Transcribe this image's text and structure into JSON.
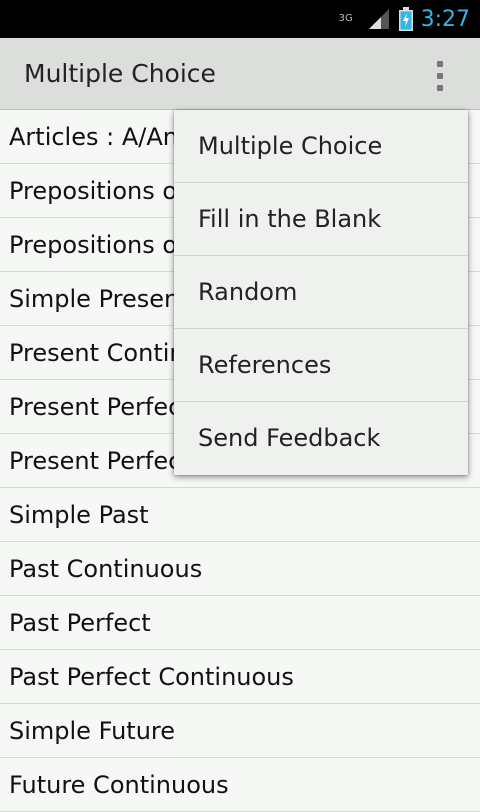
{
  "status_bar": {
    "network_type": "3G",
    "time": "3:27",
    "icons": [
      "signal-icon",
      "battery-charging-icon"
    ],
    "accent_color": "#33b5e5"
  },
  "action_bar": {
    "title": "Multiple Choice",
    "overflow_icon": "overflow-menu-icon"
  },
  "list": {
    "items": [
      "Articles : A/An",
      "Prepositions o",
      "Prepositions o",
      "Simple Presen",
      "Present Contin",
      "Present Perfec",
      "Present Perfec",
      "Simple Past",
      "Past Continuous",
      "Past Perfect",
      "Past Perfect Continuous",
      "Simple Future",
      "Future Continuous"
    ]
  },
  "menu": {
    "items": [
      "Multiple Choice",
      "Fill in the Blank",
      "Random",
      "References",
      "Send Feedback"
    ]
  }
}
